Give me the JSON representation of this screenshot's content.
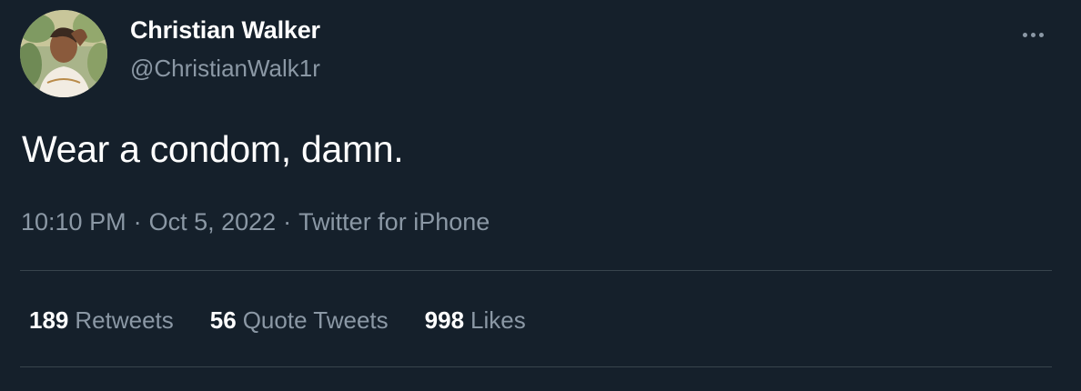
{
  "user": {
    "display_name": "Christian Walker",
    "handle": "@ChristianWalk1r",
    "avatar_icon": "profile-photo"
  },
  "tweet": {
    "text": "Wear a condom, damn.",
    "time": "10:10 PM",
    "date": "Oct 5, 2022",
    "source": "Twitter for iPhone",
    "separator": "·"
  },
  "stats": {
    "retweets": {
      "count": "189",
      "label": "Retweets"
    },
    "quote_tweets": {
      "count": "56",
      "label": "Quote Tweets"
    },
    "likes": {
      "count": "998",
      "label": "Likes"
    }
  },
  "colors": {
    "background": "#15202b",
    "primary_text": "#ffffff",
    "secondary_text": "#8b98a5",
    "divider": "#38444d"
  }
}
